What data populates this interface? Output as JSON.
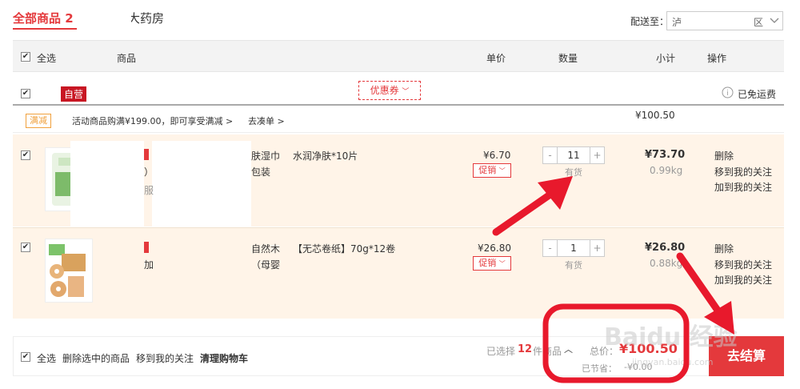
{
  "header": {
    "tab_all": "全部商品 2",
    "tab_pharmacy": "大药房",
    "deliver_label": "配送至：",
    "deliver_value": "泸",
    "deliver_region": "区"
  },
  "table_head": {
    "select_all": "全选",
    "product": "商品",
    "price": "单价",
    "qty": "数量",
    "subtotal": "小计",
    "ops": "操作"
  },
  "shop": {
    "self_badge": "自营",
    "coupon": "优惠券",
    "free_ship": "已免运费"
  },
  "promo": {
    "badge": "满减",
    "text": "活动商品购满¥199.00，即可享受满减 >",
    "link": "去凑单 >",
    "group_total": "¥100.50"
  },
  "items": [
    {
      "name_line1": "肤湿巾",
      "name_line2": "包装",
      "name_frag": "）",
      "service_frag": "服",
      "spec": "水润净肤*10片",
      "price": "¥6.70",
      "promo": "促销",
      "qty": "11",
      "stock": "有货",
      "subtotal": "¥73.70",
      "weight": "0.99kg",
      "op_delete": "删除",
      "op_follow": "移到我的关注",
      "op_add_follow": "加到我的关注"
    },
    {
      "name_line1": "自然木",
      "name_line2": "（母婴",
      "name_frag": "加",
      "spec": "【无芯卷纸】70g*12卷",
      "price": "¥26.80",
      "promo": "促销",
      "qty": "1",
      "stock": "有货",
      "subtotal": "¥26.80",
      "weight": "0.88kg",
      "op_delete": "删除",
      "op_follow": "移到我的关注",
      "op_add_follow": "加到我的关注"
    }
  ],
  "footer": {
    "select_all": "全选",
    "delete_selected": "删除选中的商品",
    "move_follow": "移到我的关注",
    "clear": "清理购物车",
    "selected_prefix": "已选择",
    "selected_count": "12",
    "selected_suffix": "件商品",
    "total_label": "总价：",
    "total_value": "¥100.50",
    "saved_label": "已节省：",
    "saved_value": "-¥0.00",
    "checkout": "去结算"
  },
  "watermark": "Baidu 经验",
  "watermark_url": "jingyan.baidu.com",
  "colors": {
    "accent": "#e4393c",
    "annotation": "#e8192c",
    "item_bg": "#fff4e8"
  }
}
